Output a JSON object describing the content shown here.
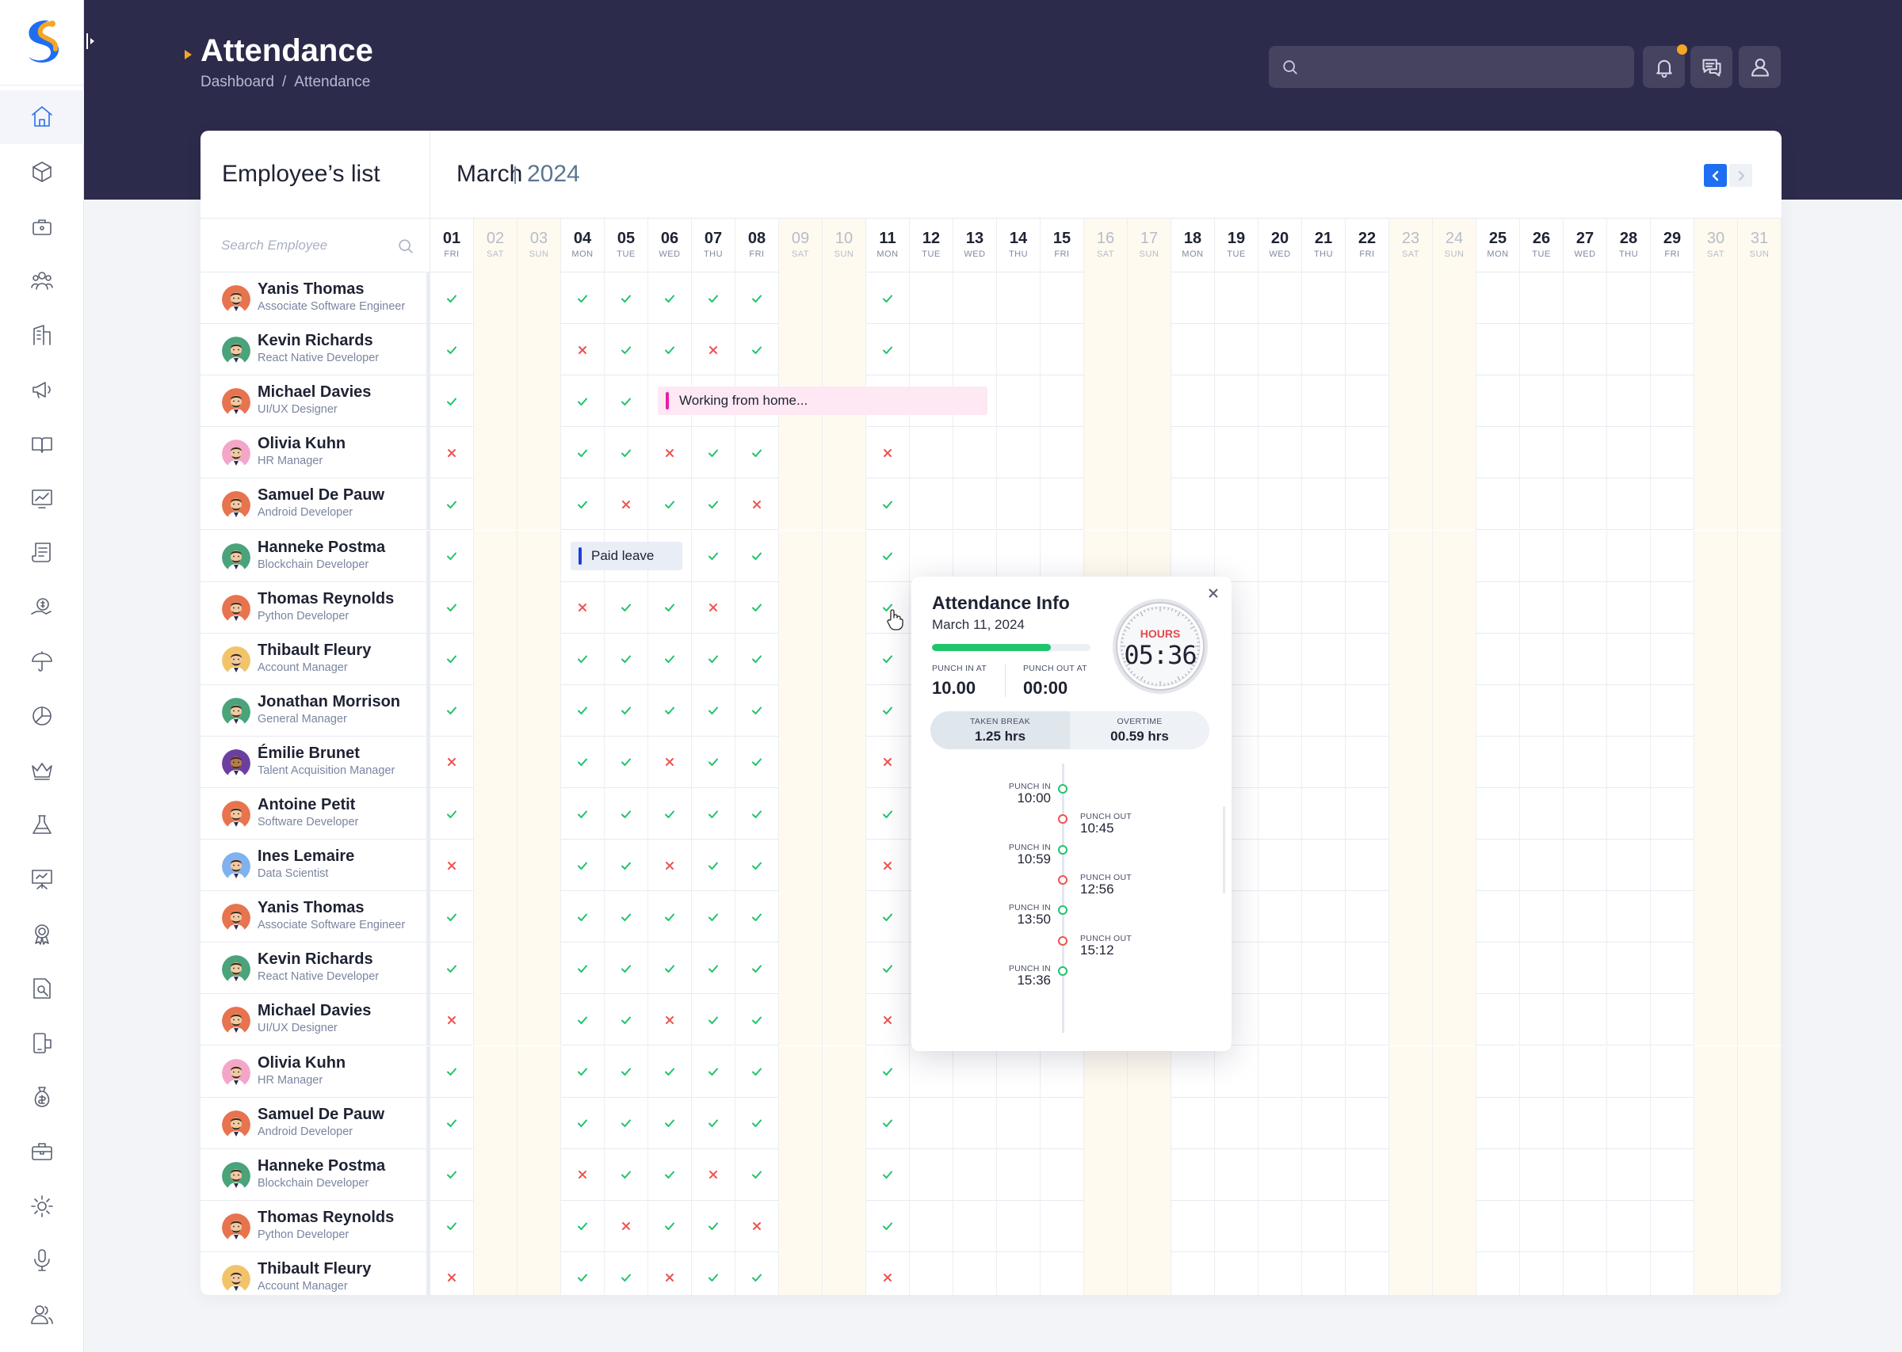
{
  "header": {
    "title": "Attendance",
    "breadcrumb": [
      "Dashboard",
      "/",
      "Attendance"
    ],
    "search_placeholder": ""
  },
  "sidebar": {
    "items": [
      "home-icon",
      "cube-icon",
      "briefcase-icon",
      "users-icon",
      "building-icon",
      "megaphone-icon",
      "book-icon",
      "chart-icon",
      "receipt-icon",
      "coin-hand-icon",
      "umbrella-icon",
      "pie-chart-icon",
      "crown-icon",
      "flask-icon",
      "presentation-icon",
      "award-icon",
      "search-document-icon",
      "mobile-icon",
      "money-bag-icon",
      "toolbox-icon",
      "settings-gear-icon",
      "microphone-icon",
      "user-group-icon"
    ]
  },
  "panel": {
    "employees_title": "Employee’s list",
    "month": "March",
    "year": "2024",
    "search_placeholder": "Search Employee"
  },
  "days": [
    {
      "n": "01",
      "w": "FRI"
    },
    {
      "n": "02",
      "w": "SAT"
    },
    {
      "n": "03",
      "w": "SUN"
    },
    {
      "n": "04",
      "w": "MON"
    },
    {
      "n": "05",
      "w": "TUE"
    },
    {
      "n": "06",
      "w": "WED"
    },
    {
      "n": "07",
      "w": "THU"
    },
    {
      "n": "08",
      "w": "FRI"
    },
    {
      "n": "09",
      "w": "SAT"
    },
    {
      "n": "10",
      "w": "SUN"
    },
    {
      "n": "11",
      "w": "MON"
    },
    {
      "n": "12",
      "w": "TUE"
    },
    {
      "n": "13",
      "w": "WED"
    },
    {
      "n": "14",
      "w": "THU"
    },
    {
      "n": "15",
      "w": "FRI"
    },
    {
      "n": "16",
      "w": "SAT"
    },
    {
      "n": "17",
      "w": "SUN"
    },
    {
      "n": "18",
      "w": "MON"
    },
    {
      "n": "19",
      "w": "TUE"
    },
    {
      "n": "20",
      "w": "WED"
    },
    {
      "n": "21",
      "w": "THU"
    },
    {
      "n": "22",
      "w": "FRI"
    },
    {
      "n": "23",
      "w": "SAT"
    },
    {
      "n": "24",
      "w": "SUN"
    },
    {
      "n": "25",
      "w": "MON"
    },
    {
      "n": "26",
      "w": "TUE"
    },
    {
      "n": "27",
      "w": "WED"
    },
    {
      "n": "28",
      "w": "THU"
    },
    {
      "n": "29",
      "w": "FRI"
    },
    {
      "n": "30",
      "w": "SAT"
    },
    {
      "n": "31",
      "w": "SUN"
    }
  ],
  "employees": [
    {
      "name": "Yanis Thomas",
      "role": "Associate Software Engineer",
      "avatar": "#e8734f",
      "att": {
        "01": "v",
        "04": "v",
        "05": "v",
        "06": "v",
        "07": "v",
        "08": "v",
        "11": "v"
      }
    },
    {
      "name": "Kevin Richards",
      "role": "React Native Developer",
      "avatar": "#4aa37a",
      "att": {
        "01": "v",
        "04": "x",
        "05": "v",
        "06": "v",
        "07": "x",
        "08": "v",
        "11": "v"
      }
    },
    {
      "name": "Michael Davies",
      "role": "UI/UX Designer",
      "avatar": "#e8734f",
      "att": {
        "01": "v",
        "04": "v",
        "05": "v"
      },
      "event": {
        "label": "Working from home...",
        "start": 6,
        "end": 13,
        "kind": "wfh"
      }
    },
    {
      "name": "Olivia Kuhn",
      "role": "HR Manager",
      "avatar": "#f3a6c8",
      "att": {
        "01": "x",
        "04": "v",
        "05": "v",
        "06": "x",
        "07": "v",
        "08": "v",
        "11": "x"
      }
    },
    {
      "name": "Samuel De Pauw",
      "role": "Android Developer",
      "avatar": "#e8734f",
      "att": {
        "01": "v",
        "04": "v",
        "05": "x",
        "06": "v",
        "07": "v",
        "08": "x",
        "11": "v"
      }
    },
    {
      "name": "Hanneke Postma",
      "role": "Blockchain Developer",
      "avatar": "#4aa37a",
      "att": {
        "01": "v",
        "07": "v",
        "08": "v",
        "11": "v"
      },
      "event": {
        "label": "Paid leave",
        "start": 4,
        "end": 6,
        "kind": "leave"
      }
    },
    {
      "name": "Thomas Reynolds",
      "role": "Python Developer",
      "avatar": "#e8734f",
      "att": {
        "01": "v",
        "04": "x",
        "05": "v",
        "06": "v",
        "07": "x",
        "08": "v",
        "11": "v"
      }
    },
    {
      "name": "Thibault Fleury",
      "role": "Account Manager",
      "avatar": "#f2c46a",
      "att": {
        "01": "v",
        "04": "v",
        "05": "v",
        "06": "v",
        "07": "v",
        "08": "v",
        "11": "v"
      }
    },
    {
      "name": "Jonathan Morrison",
      "role": "General Manager",
      "avatar": "#4aa37a",
      "att": {
        "01": "v",
        "04": "v",
        "05": "v",
        "06": "v",
        "07": "v",
        "08": "v",
        "11": "v"
      }
    },
    {
      "name": "Émilie Brunet",
      "role": "Talent Acquisition Manager",
      "avatar": "#6b3fa0",
      "att": {
        "01": "x",
        "04": "v",
        "05": "v",
        "06": "x",
        "07": "v",
        "08": "v",
        "11": "x"
      }
    },
    {
      "name": "Antoine Petit",
      "role": "Software Developer",
      "avatar": "#e8734f",
      "att": {
        "01": "v",
        "04": "v",
        "05": "v",
        "06": "v",
        "07": "v",
        "08": "v",
        "11": "v"
      }
    },
    {
      "name": "Ines Lemaire",
      "role": "Data Scientist",
      "avatar": "#7fb2ee",
      "att": {
        "01": "x",
        "04": "v",
        "05": "v",
        "06": "x",
        "07": "v",
        "08": "v",
        "11": "x"
      }
    },
    {
      "name": "Yanis Thomas",
      "role": "Associate Software Engineer",
      "avatar": "#e8734f",
      "att": {
        "01": "v",
        "04": "v",
        "05": "v",
        "06": "v",
        "07": "v",
        "08": "v",
        "11": "v"
      }
    },
    {
      "name": "Kevin Richards",
      "role": "React Native Developer",
      "avatar": "#4aa37a",
      "att": {
        "01": "v",
        "04": "v",
        "05": "v",
        "06": "v",
        "07": "v",
        "08": "v",
        "11": "v"
      }
    },
    {
      "name": "Michael Davies",
      "role": "UI/UX Designer",
      "avatar": "#e8734f",
      "att": {
        "01": "x",
        "04": "v",
        "05": "v",
        "06": "x",
        "07": "v",
        "08": "v",
        "11": "x"
      }
    },
    {
      "name": "Olivia Kuhn",
      "role": "HR Manager",
      "avatar": "#f3a6c8",
      "att": {
        "01": "v",
        "04": "v",
        "05": "v",
        "06": "v",
        "07": "v",
        "08": "v",
        "11": "v"
      }
    },
    {
      "name": "Samuel De Pauw",
      "role": "Android Developer",
      "avatar": "#e8734f",
      "att": {
        "01": "v",
        "04": "v",
        "05": "v",
        "06": "v",
        "07": "v",
        "08": "v",
        "11": "v"
      }
    },
    {
      "name": "Hanneke Postma",
      "role": "Blockchain Developer",
      "avatar": "#4aa37a",
      "att": {
        "01": "v",
        "04": "x",
        "05": "v",
        "06": "v",
        "07": "x",
        "08": "v",
        "11": "v"
      }
    },
    {
      "name": "Thomas Reynolds",
      "role": "Python Developer",
      "avatar": "#e8734f",
      "att": {
        "01": "v",
        "04": "v",
        "05": "x",
        "06": "v",
        "07": "v",
        "08": "x",
        "11": "v"
      }
    },
    {
      "name": "Thibault Fleury",
      "role": "Account Manager",
      "avatar": "#f2c46a",
      "att": {
        "01": "x",
        "04": "v",
        "05": "v",
        "06": "x",
        "07": "v",
        "08": "v",
        "11": "x"
      }
    }
  ],
  "popup": {
    "title": "Attendance Info",
    "date": "March 11, 2024",
    "progress": 0.75,
    "punch_in_label": "PUNCH IN AT",
    "punch_in_value": "10.00",
    "punch_out_label": "PUNCH OUT AT",
    "punch_out_value": "00:00",
    "hours_label": "HOURS",
    "hours_value": "05:36",
    "break_label": "TAKEN BREAK",
    "break_value": "1.25 hrs",
    "overtime_label": "OVERTIME",
    "overtime_value": "00.59 hrs",
    "timeline": [
      {
        "type": "in",
        "label": "PUNCH IN",
        "time": "10:00"
      },
      {
        "type": "out",
        "label": "PUNCH OUT",
        "time": "10:45"
      },
      {
        "type": "in",
        "label": "PUNCH IN",
        "time": "10:59"
      },
      {
        "type": "out",
        "label": "PUNCH OUT",
        "time": "12:56"
      },
      {
        "type": "in",
        "label": "PUNCH IN",
        "time": "13:50"
      },
      {
        "type": "out",
        "label": "PUNCH OUT",
        "time": "15:12"
      },
      {
        "type": "in",
        "label": "PUNCH IN",
        "time": "15:36"
      }
    ]
  },
  "colors": {
    "accent": "#1f6ef1",
    "present": "#20c46a",
    "absent": "#ef5350",
    "header_bg": "#2d2b4b",
    "weekend": "#fffaf0"
  }
}
